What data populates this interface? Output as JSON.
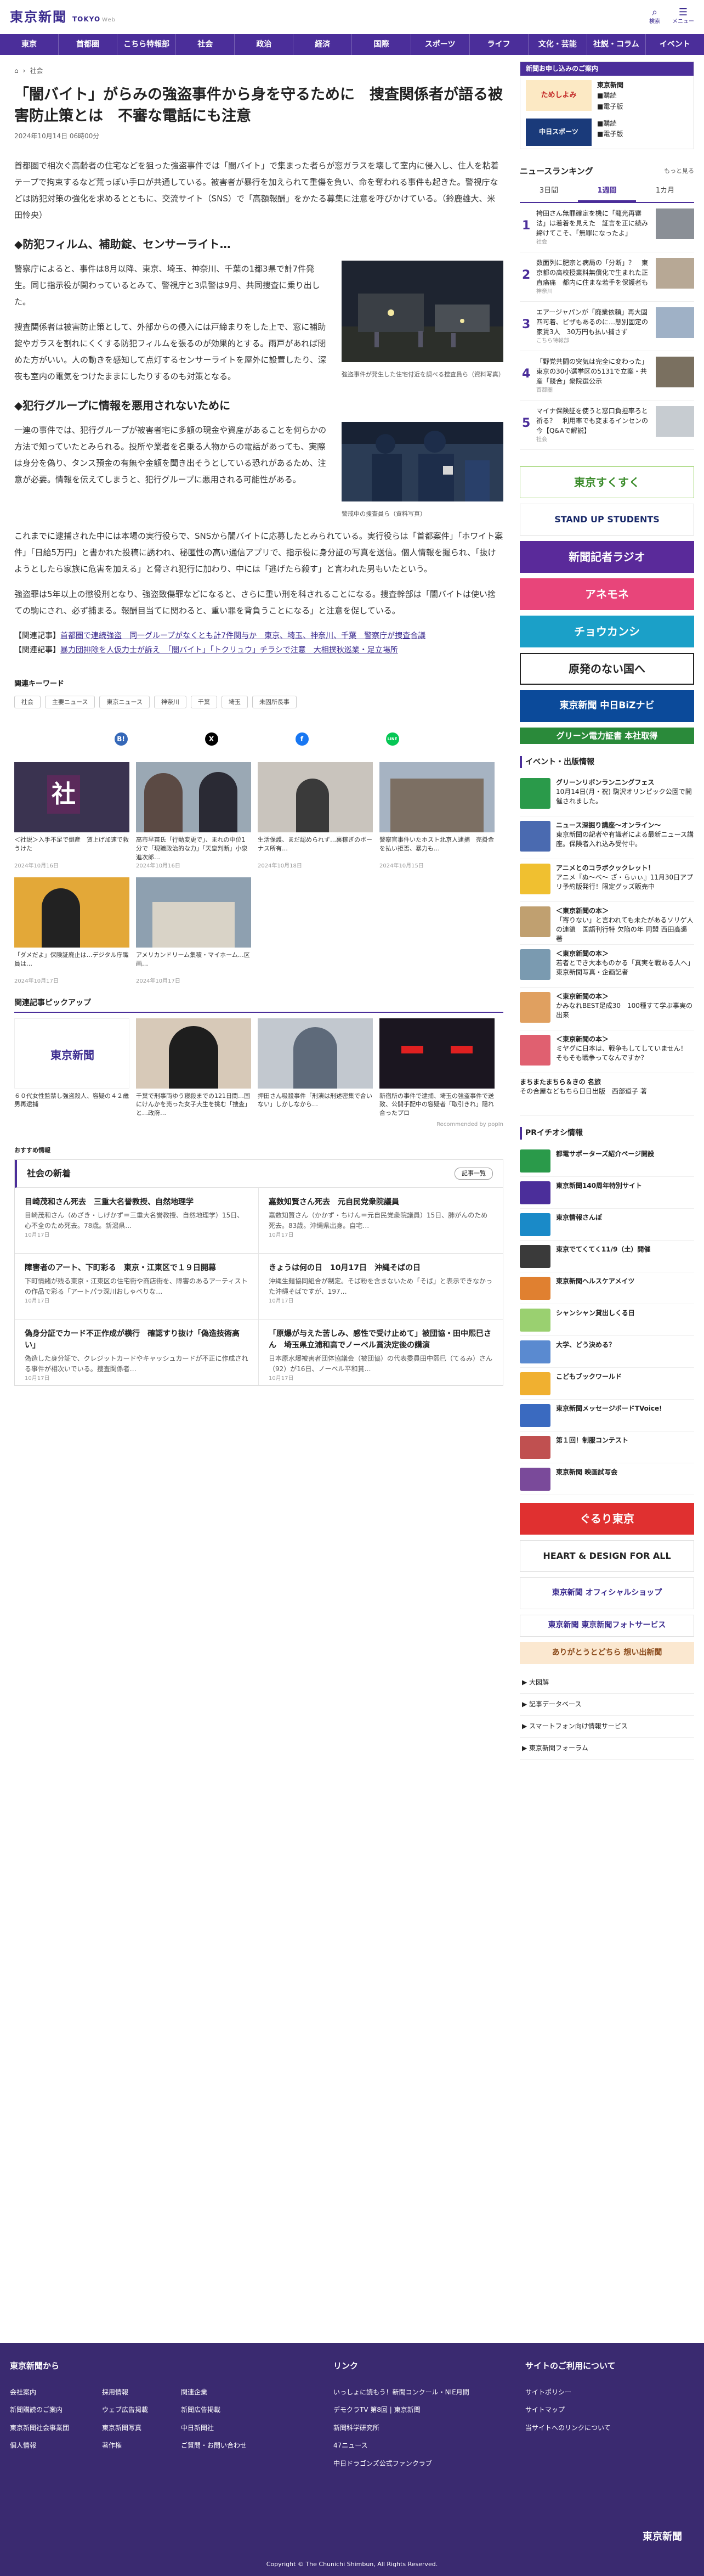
{
  "header": {
    "logo_jp": "東京新聞",
    "logo_en": "TOKYO",
    "logo_web": "Web",
    "search_label": "検索",
    "menu_label": "メニュー"
  },
  "nav": [
    "東京",
    "首都圏",
    "こちら特報部",
    "社会",
    "政治",
    "経済",
    "国際",
    "スポーツ",
    "ライフ",
    "文化・芸能",
    "社説・コラム",
    "イベント"
  ],
  "breadcrumb": {
    "home_icon": "home-icon",
    "section": "社会"
  },
  "article": {
    "title": "「闇バイト」がらみの強盗事件から身を守るために　捜査関係者が語る被害防止策とは　不審な電話にも注意",
    "date": "2024年10月14日 06時00分",
    "lead": "首都圏で相次ぐ高齢者の住宅などを狙った強盗事件では「闇バイト」で集まった者らが窓ガラスを壊して室内に侵入し、住人を粘着テープで拘束するなど荒っぽい手口が共通している。被害者が暴行を加えられて重傷を負い、命を奪われる事件も起きた。警視庁などは防犯対策の強化を求めるとともに、交流サイト（SNS）で「高額報酬」をかたる募集に注意を呼びかけている。（鈴鹿雄大、米田怜央）",
    "sec1_title": "◆防犯フィルム、補助錠、センサーライト…",
    "sec1_p1": "警察庁によると、事件は8月以降、東京、埼玉、神奈川、千葉の1都3県で計7件発生。同じ指示役が関わっているとみて、警視庁と3県警は9月、共同捜査に乗り出した。",
    "sec1_p2": "捜査関係者は被害防止策として、外部からの侵入には戸締まりをした上で、窓に補助錠やガラスを割れにくくする防犯フィルムを張るのが効果的とする。雨戸があれば閉めた方がいい。人の動きを感知して点灯するセンサーライトを屋外に設置したり、深夜も室内の電気をつけたままにしたりするのも対策となる。",
    "fig1_cap": "強盗事件が発生した住宅付近を調べる捜査員ら（資料写真）",
    "sec2_title": "◆犯行グループに情報を悪用されないために",
    "sec2_p1": "一連の事件では、犯行グループが被害者宅に多額の現金や資産があることを何らかの方法で知っていたとみられる。投所や業者を名乗る人物からの電話があっても、実際は身分を偽り、タンス預金の有無や金額を聞き出そうとしている恐れがあるため、注意が必要。情報を伝えてしまうと、犯行グループに悪用される可能性がある。",
    "fig2_cap": "警戒中の捜査員ら（資料写真）",
    "p3": "これまでに逮捕された中には本場の実行役らで、SNSから闇バイトに応募したとみられている。実行役らは「首都案件」「ホワイト案件」「日給5万円」と書かれた投稿に誘われ、秘匿性の高い通信アプリで、指示役に身分証の写真を送信。個人情報を握られ、「抜けようとしたら家族に危害を加える」と脅され犯行に加わり、中には「逃げたら殺す」と言われた男もいたという。",
    "p4": "強盗罪は5年以上の懲役刑となり、強盗致傷罪などになると、さらに重い刑を科されることになる。捜査幹部は「闇バイトは使い捨ての駒にされ、必ず捕まる。報酬目当てに関わると、重い罪を背負うことになる」と注意を促している。",
    "rel1_label": "【関連記事】",
    "rel1_text": "首都圏で連続強盗　同一グループがなくとも計7件関与か　東京、埼玉、神奈川、千葉　警察庁が捜査合議",
    "rel2_label": "【関連記事】",
    "rel2_text": "暴力団排除を人仮力士が訴え　「闇バイト」「トクリュウ」チラシで注意　大相撲秋巡業・足立場所"
  },
  "keywords": {
    "title": "関連キーワード",
    "items": [
      "社会",
      "主要ニュース",
      "東京ニュース",
      "神奈川",
      "千葉",
      "埼玉",
      "未固所長事"
    ]
  },
  "share": [
    "B!",
    "X",
    "f",
    "LINE"
  ],
  "related": [
    {
      "title": "＜社説＞入手不足で倒産　賃上げ加速で救うけた",
      "date": "2024年10月16日"
    },
    {
      "title": "高市早苗氏「行動変更で」、まれの中位1分で「現職政治的な力」「天皇判断」小泉進次郎…",
      "date": "2024年10月16日"
    },
    {
      "title": "生活保護、まだ認められず…裏稼ぎのボーナス所有…",
      "date": "2024年10月18日"
    },
    {
      "title": "警察官事件いたホスト北京人逮捕　売掛金を払い拒否、暴力も…",
      "date": "2024年10月15日"
    },
    {
      "title": "「ダメだよ」保険証廃止は…デジタル庁職員は…",
      "date": "2024年10月17日"
    },
    {
      "title": "アメリカンドリーム集積・マイホーム…区画…",
      "date": "2024年10月17日"
    }
  ],
  "pickup": {
    "title": "関連記事ピックアップ",
    "items": [
      {
        "title": "６０代女性監禁し強盗殺人、容疑の４２歳男再逮捕"
      },
      {
        "title": "千葉で刑事両ゆう寝殺までの121日間…国にけんかを売った女子大生を挑む「捜査」と…政府…"
      },
      {
        "title": "押田さん吸殺事件「刑演は刑述密集で合いない」しかしなから…"
      },
      {
        "title": "新宿所の事件で逮捕、埼玉の強盗事件で送致、公開手配中の容疑者「取引きれ」隠れ合ったプロ"
      }
    ],
    "rec": "Recommended by popIn"
  },
  "osusume": "おすすめ情報",
  "news": {
    "title": "社会の新着",
    "more": "記事一覧",
    "items": [
      {
        "title": "目崎茂和さん死去　三重大名誉教授、自然地理学",
        "desc": "目崎茂和さん（めざき・しげかず＝三重大名誉教授、自然地理学）15日、心不全のため死去。78歳。新潟県…",
        "date": "10月17日"
      },
      {
        "title": "嘉数知賢さん死去　元自民党衆院議員",
        "desc": "嘉数知賢さん（かかず・ちけん＝元自民党衆院議員）15日、肺がんのため死去。83歳。沖縄県出身。自宅…",
        "date": "10月17日"
      },
      {
        "title": "障害者のアート、下町彩る　東京・江東区で１９日開幕",
        "desc": "下町情緒が残る東京・江東区の住宅街や商店街を、障害のあるアーティストの作品で彩る「アートパラ深川おしゃべりな…",
        "date": "10月17日"
      },
      {
        "title": "きょうは何の日　10月17日　沖縄そばの日",
        "desc": "沖縄生麺協同組合が制定。そば粉を含まないため「そば」と表示できなかった沖縄そばですが、197…",
        "date": "10月17日"
      },
      {
        "title": "偽身分証でカード不正作成が横行　確認すり抜け「偽造技術高い」",
        "desc": "偽造した身分証で、クレジットカードやキャッシュカードが不正に作成される事件が相次いでいる。捜査関係者…",
        "date": "10月17日"
      },
      {
        "title": "「原爆が与えた苦しみ、感性で受け止めて」被団協・田中煕巳さん　埼玉県立浦和高でノーベル賞決定後の講演",
        "desc": "日本原水爆被害者団体協議会（被団協）の代表委員田中煕巳（てるみ）さん（92）が16日、ノーベル平和賞…",
        "date": "10月17日"
      }
    ]
  },
  "sidebar": {
    "promo": {
      "title": "新聞お申し込みのご案内",
      "line1": "東京新聞",
      "line2": "購読",
      "line3": "ためしよみ",
      "line4": "電子版",
      "line5": "中日スポーツ",
      "line6": "購読",
      "line7": "電子版"
    },
    "ranking": {
      "title": "ニュースランキング",
      "more": "もっと見る",
      "tabs": [
        "3日間",
        "1週間",
        "1カ月"
      ],
      "items": [
        {
          "rank": "1",
          "title": "袴田さん無罪確定を機に「龍光再審法」は着着を見えた　証言を正に続み締けてこそ、「無罪になったよ」",
          "cat": "社会"
        },
        {
          "rank": "2",
          "title": "数面列に肥宗と病局の「分断」？　東京都の高校授業料無償化で生まれた正直痛痛　都内に住まな若手を保護者も",
          "cat": "神奈川"
        },
        {
          "rank": "3",
          "title": "エアージャパンが「廃業依頼」再大固四可着、ビザもあるのに…態別固定の家賃3人　30万円も払い捕さず",
          "cat": "こちら特報部"
        },
        {
          "rank": "4",
          "title": "「野党共闘の突気は完全に変わった」東京の30小選挙区の5131で立案・共産「競合」衆院選公示",
          "cat": "首都圏"
        },
        {
          "rank": "5",
          "title": "マイナ保険証を使うと窓口負担率ろと祈る？　利用率でも変まるインセンの今【Q&Aで解説】",
          "cat": "社会"
        }
      ]
    },
    "banners": [
      "東京すくすく",
      "STAND UP STUDENTS",
      "新聞記者ラジオ",
      "アネモネ",
      "チョウカンシ",
      "原発のない国へ",
      "東京新聞 中日BiZナビ",
      "グリーン電力証書 本社取得"
    ],
    "events_title": "イベント・出版情報",
    "events": [
      {
        "title": "グリーンリボンランニングフェス",
        "desc": "10月14日(月・祝) 駒沢オリンピック公園で開催されました。"
      },
      {
        "title": "ニュース深掘り講座〜オンライン〜",
        "desc": "東京新聞の記者や有識者による最新ニュース講座。保険者入れ込み受付中。"
      },
      {
        "title": "アニメとのコラボクックレット！",
        "desc": "アニメ『ぬ〜べ〜 ざ・らぃぃ』11月30日アプリ予約版発行！限定グッズ販売中"
      },
      {
        "title": "＜東京新聞の本＞",
        "desc": "「寄りない」と言われても未たがあるソリゲ人の連鎖　国語刊行特 欠陥の年 同盟 西田高遥 著"
      },
      {
        "title": "＜東京新聞の本＞",
        "desc": "若者とでき大本ものかる「真実を戦ある人へ」東京新聞写真・企画記者"
      },
      {
        "title": "＜東京新聞の本＞",
        "desc": "かみなれBEST足成30　100種すて学ぶ事実の出来"
      },
      {
        "title": "＜東京新聞の本＞",
        "desc": "ミヤグに日本は、戦争もしてしていません！　そもそも戦争ってなんですか？"
      }
    ],
    "mansion": {
      "title": "まちまたまちら＆きの 名旅",
      "desc": "その合屋などもちら日日出版　西部道子 著"
    },
    "pr_title": "PRイチオシ情報",
    "pr": [
      {
        "title": "都電サポーターズ紹介ページ開設"
      },
      {
        "title": "東京新聞140周年特別サイト"
      },
      {
        "title": "東京情報さんぽ"
      },
      {
        "title": "東京でてくてく11/9（土）開催"
      },
      {
        "title": "東京新聞ヘルスケアメイツ"
      },
      {
        "title": "シャンシャン貸出しくる日"
      },
      {
        "title": "大学、どう決める？"
      },
      {
        "title": "こどもブックワールド"
      },
      {
        "title": "東京新聞メッセージボードTVoice!"
      },
      {
        "title": "第１回！制服コンテスト"
      },
      {
        "title": "東京新聞 映画試写会"
      }
    ],
    "bottom_banners": [
      "ぐるり東京",
      "HEART & DESIGN FOR ALL",
      "東京新聞 オフィシャルショップ",
      "東京新聞 東京新聞フォトサービス",
      "ありがとうとどちら 想い出新聞"
    ],
    "links": [
      "大図解",
      "記事データベース",
      "スマートフォン向け情報サービス",
      "東京新聞フォーラム"
    ]
  },
  "footer": {
    "col1_title": "東京新聞から",
    "col1": [
      [
        "会社案内",
        "採用情報",
        "関連企業"
      ],
      [
        "新聞購読のご案内",
        "ウェブ広告掲載",
        "新聞広告掲載"
      ],
      [
        "東京新聞社会事業団",
        "東京新聞写真",
        "中日新聞社"
      ],
      [
        "個人情報",
        "著作権",
        "ご質問・お問い合わせ"
      ]
    ],
    "col2_title": "リンク",
    "col2": [
      [
        "いっしょに読もう！新聞コンクール・NIE月間"
      ],
      [
        "デモクラTV 第8回 | 東京新聞"
      ],
      [
        "新聞科学研究所"
      ],
      [
        "47ニュース"
      ],
      [
        "中日ドラゴンズ公式ファンクラブ"
      ]
    ],
    "col3_title": "サイトのご利用について",
    "col3": [
      "サイトポリシー",
      "サイトマップ",
      "当サイトへのリンクについて"
    ],
    "copyright": "Copyright © The Chunichi Shimbun, All Rights Reserved.",
    "logo": "東京新聞"
  },
  "colors": {
    "brand": "#4b2e9a",
    "footer": "#3a2a70"
  }
}
